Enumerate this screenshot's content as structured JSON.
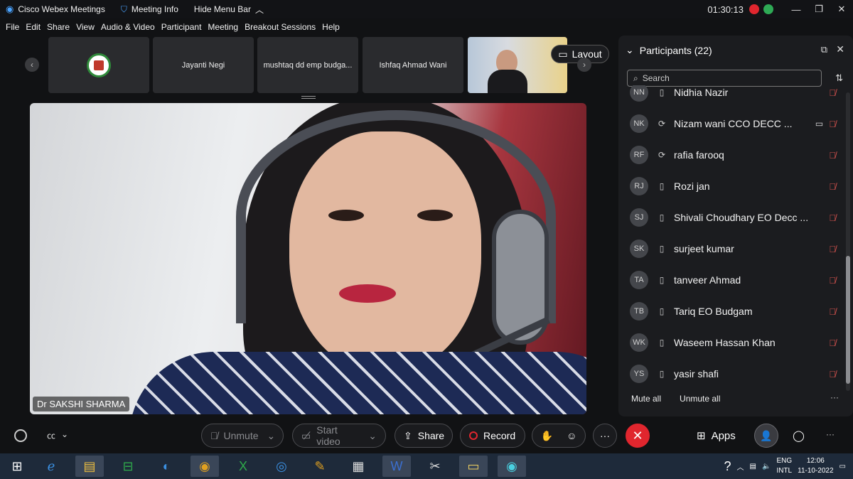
{
  "titlebar": {
    "app_name": "Cisco Webex Meetings",
    "meeting_info": "Meeting Info",
    "hide_menu": "Hide Menu Bar",
    "time": "01:30:13"
  },
  "menu": [
    "File",
    "Edit",
    "Share",
    "View",
    "Audio & Video",
    "Participant",
    "Meeting",
    "Breakout Sessions",
    "Help"
  ],
  "thumbnails": [
    {
      "label": ""
    },
    {
      "label": "Jayanti Negi"
    },
    {
      "label": "mushtaq dd emp budga..."
    },
    {
      "label": "Ishfaq Ahmad Wani"
    },
    {
      "label": ""
    }
  ],
  "layout_label": "Layout",
  "main_video": {
    "name": "Dr SAKSHI SHARMA"
  },
  "participants": {
    "title": "Participants (22)",
    "search_placeholder": "Search",
    "rows": [
      {
        "initials": "NN",
        "name": "Nidhia Nazir",
        "device": "phone"
      },
      {
        "initials": "NK",
        "name": "Nizam wani CCO DECC ...",
        "device": "sync"
      },
      {
        "initials": "RF",
        "name": "rafia farooq",
        "device": "sync"
      },
      {
        "initials": "RJ",
        "name": "Rozi jan",
        "device": "phone"
      },
      {
        "initials": "SJ",
        "name": "Shivali Choudhary EO Decc ...",
        "device": "phone"
      },
      {
        "initials": "SK",
        "name": "surjeet kumar",
        "device": "phone"
      },
      {
        "initials": "TA",
        "name": "tanveer Ahmad",
        "device": "phone"
      },
      {
        "initials": "TB",
        "name": "Tariq EO Budgam",
        "device": "phone"
      },
      {
        "initials": "WK",
        "name": "Waseem Hassan Khan",
        "device": "phone"
      },
      {
        "initials": "YS",
        "name": "yasir shafi",
        "device": "phone"
      }
    ],
    "mute_all": "Mute all",
    "unmute_all": "Unmute all"
  },
  "controls": {
    "unmute": "Unmute",
    "start_video": "Start video",
    "share": "Share",
    "record": "Record",
    "apps": "Apps"
  },
  "taskbar": {
    "lang1": "ENG",
    "lang2": "INTL",
    "time": "12:06",
    "date": "11-10-2022"
  },
  "colors": {
    "end_call": "#e0262e",
    "muted_mic": "#d9534f",
    "accent": "#0b84ff"
  }
}
